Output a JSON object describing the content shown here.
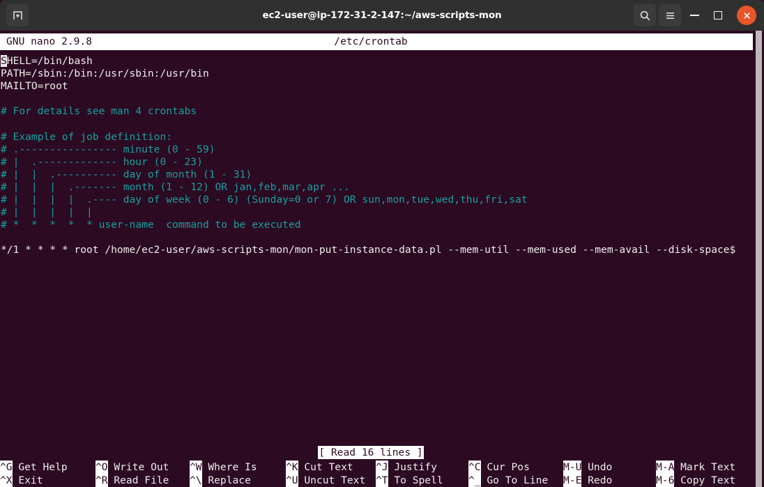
{
  "titlebar": {
    "title": "ec2-user@ip-172-31-2-147:~/aws-scripts-mon",
    "new_tab_icon": "new-terminal-icon",
    "search_icon": "search-icon",
    "menu_icon": "hamburger-menu-icon",
    "minimize_icon": "minimize-icon",
    "maximize_icon": "maximize-icon",
    "close_icon": "close-icon",
    "accent_close": "#e8552a",
    "bar_background": "#303030"
  },
  "nano": {
    "version_label": "GNU nano 2.9.8",
    "filename": "/etc/crontab",
    "status_message": "[ Read 16 lines ]",
    "background": "#2c0a22",
    "foreground": "#eeeeec",
    "comment_color": "#18a0a0",
    "cursor_char": "S",
    "lines": [
      {
        "type": "plain",
        "cursor": true,
        "cursor_text": "S",
        "text": "HELL=/bin/bash"
      },
      {
        "type": "plain",
        "cursor": false,
        "text": "PATH=/sbin:/bin:/usr/sbin:/usr/bin"
      },
      {
        "type": "plain",
        "cursor": false,
        "text": "MAILTO=root"
      },
      {
        "type": "plain",
        "cursor": false,
        "text": ""
      },
      {
        "type": "comment",
        "cursor": false,
        "text": "# For details see man 4 crontabs"
      },
      {
        "type": "plain",
        "cursor": false,
        "text": ""
      },
      {
        "type": "comment",
        "cursor": false,
        "text": "# Example of job definition:"
      },
      {
        "type": "comment",
        "cursor": false,
        "text": "# .---------------- minute (0 - 59)"
      },
      {
        "type": "comment",
        "cursor": false,
        "text": "# |  .------------- hour (0 - 23)"
      },
      {
        "type": "comment",
        "cursor": false,
        "text": "# |  |  .---------- day of month (1 - 31)"
      },
      {
        "type": "comment",
        "cursor": false,
        "text": "# |  |  |  .------- month (1 - 12) OR jan,feb,mar,apr ..."
      },
      {
        "type": "comment",
        "cursor": false,
        "text": "# |  |  |  |  .---- day of week (0 - 6) (Sunday=0 or 7) OR sun,mon,tue,wed,thu,fri,sat"
      },
      {
        "type": "comment",
        "cursor": false,
        "text": "# |  |  |  |  |"
      },
      {
        "type": "comment",
        "cursor": false,
        "text": "# *  *  *  *  * user-name  command to be executed"
      },
      {
        "type": "plain",
        "cursor": false,
        "text": ""
      },
      {
        "type": "plain",
        "cursor": false,
        "text": "*/1 * * * * root /home/ec2-user/aws-scripts-mon/mon-put-instance-data.pl --mem-util --mem-used --mem-avail --disk-space$"
      }
    ]
  },
  "shortcuts": {
    "row1": [
      {
        "key": "^G",
        "label": "Get Help"
      },
      {
        "key": "^O",
        "label": "Write Out"
      },
      {
        "key": "^W",
        "label": "Where Is"
      },
      {
        "key": "^K",
        "label": "Cut Text"
      },
      {
        "key": "^J",
        "label": "Justify"
      },
      {
        "key": "^C",
        "label": "Cur Pos"
      },
      {
        "key": "M-U",
        "label": "Undo"
      },
      {
        "key": "M-A",
        "label": "Mark Text"
      }
    ],
    "row2": [
      {
        "key": "^X",
        "label": "Exit"
      },
      {
        "key": "^R",
        "label": "Read File"
      },
      {
        "key": "^\\",
        "label": "Replace"
      },
      {
        "key": "^U",
        "label": "Uncut Text"
      },
      {
        "key": "^T",
        "label": "To Spell"
      },
      {
        "key": "^_",
        "label": "Go To Line"
      },
      {
        "key": "M-E",
        "label": "Redo"
      },
      {
        "key": "M-6",
        "label": "Copy Text"
      }
    ]
  },
  "scrollbar": {
    "thumb_color": "#bdb8bd",
    "track_color": "#2c0a22"
  }
}
